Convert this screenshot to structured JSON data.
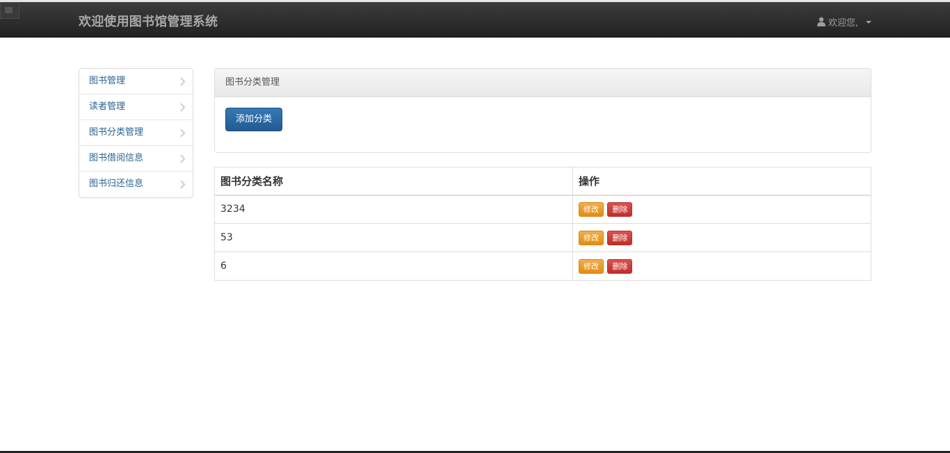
{
  "navbar": {
    "brand": "欢迎使用图书馆管理系统",
    "user_greeting": "欢迎您,"
  },
  "sidebar": {
    "items": [
      {
        "label": "图书管理"
      },
      {
        "label": "读者管理"
      },
      {
        "label": "图书分类管理"
      },
      {
        "label": "图书借阅信息"
      },
      {
        "label": "图书归还信息"
      }
    ]
  },
  "panel": {
    "title": "图书分类管理",
    "add_button": "添加分类"
  },
  "table": {
    "headers": [
      "图书分类名称",
      "操作"
    ],
    "rows": [
      {
        "name": "3234",
        "edit": "修改",
        "delete": "删除"
      },
      {
        "name": "53",
        "edit": "修改",
        "delete": "删除"
      },
      {
        "name": "6",
        "edit": "修改",
        "delete": "删除"
      }
    ]
  },
  "colors": {
    "navbar": "#222222",
    "link": "#2a6496",
    "primary": "#286090",
    "warning": "#f0ad4e",
    "danger": "#d9534f"
  },
  "icons": [
    "user-icon",
    "caret-down-icon",
    "chevron-right-icon"
  ]
}
